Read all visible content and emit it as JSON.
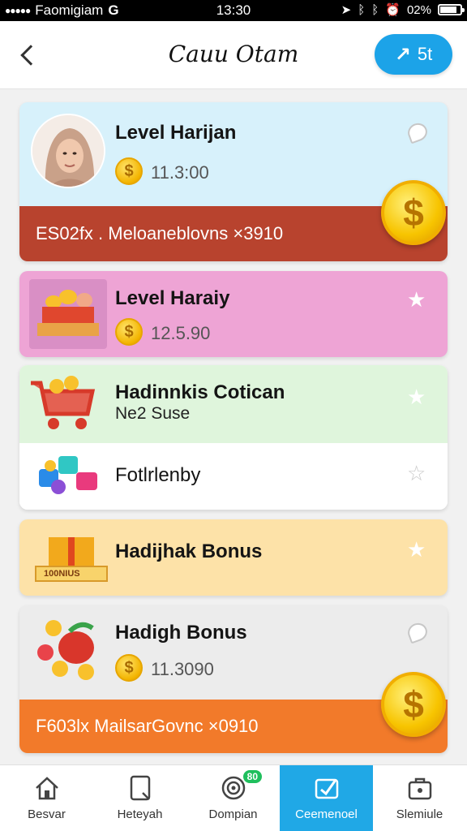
{
  "status_bar": {
    "carrier": "Faomigiam",
    "network": "G",
    "time": "13:30",
    "battery": "02%",
    "battery_level": 0.85
  },
  "header": {
    "title": "Cauu Otam",
    "action_label": "5t"
  },
  "cards": [
    {
      "title": "Level Harijan",
      "amount": "11.3:00",
      "banner": "ES02fx . Meloaneblovns ×3910"
    },
    {
      "title": "Level Haraiy",
      "amount": "12.5.90"
    },
    {
      "title": "Hadinnkis Cotican",
      "subtitle": "Ne2 Suse"
    },
    {
      "title": "Fotlrlenby"
    },
    {
      "title": "Hadijhak Bonus",
      "image_label": "100NIUS"
    },
    {
      "title": "Hadigh Bonus",
      "amount": "11.3090",
      "banner": "F603lx  MailsarGovnc ×0910"
    }
  ],
  "colors": {
    "accent": "#1ca3e8",
    "card1_bg": "#d7f1fb",
    "card1_banner": "#b8432e",
    "card2_bg": "#eea4d5",
    "card3_bg": "#dff5dc",
    "card5_bg": "#fde2a8",
    "card6_banner": "#f27a2a"
  },
  "nav": [
    {
      "label": "Besvar",
      "icon": "home-icon"
    },
    {
      "label": "Heteyah",
      "icon": "tablet-icon"
    },
    {
      "label": "Dompian",
      "icon": "target-icon",
      "badge": "80"
    },
    {
      "label": "Ceemenoel",
      "icon": "ticket-icon",
      "active": true
    },
    {
      "label": "Slemiule",
      "icon": "bag-icon"
    }
  ]
}
